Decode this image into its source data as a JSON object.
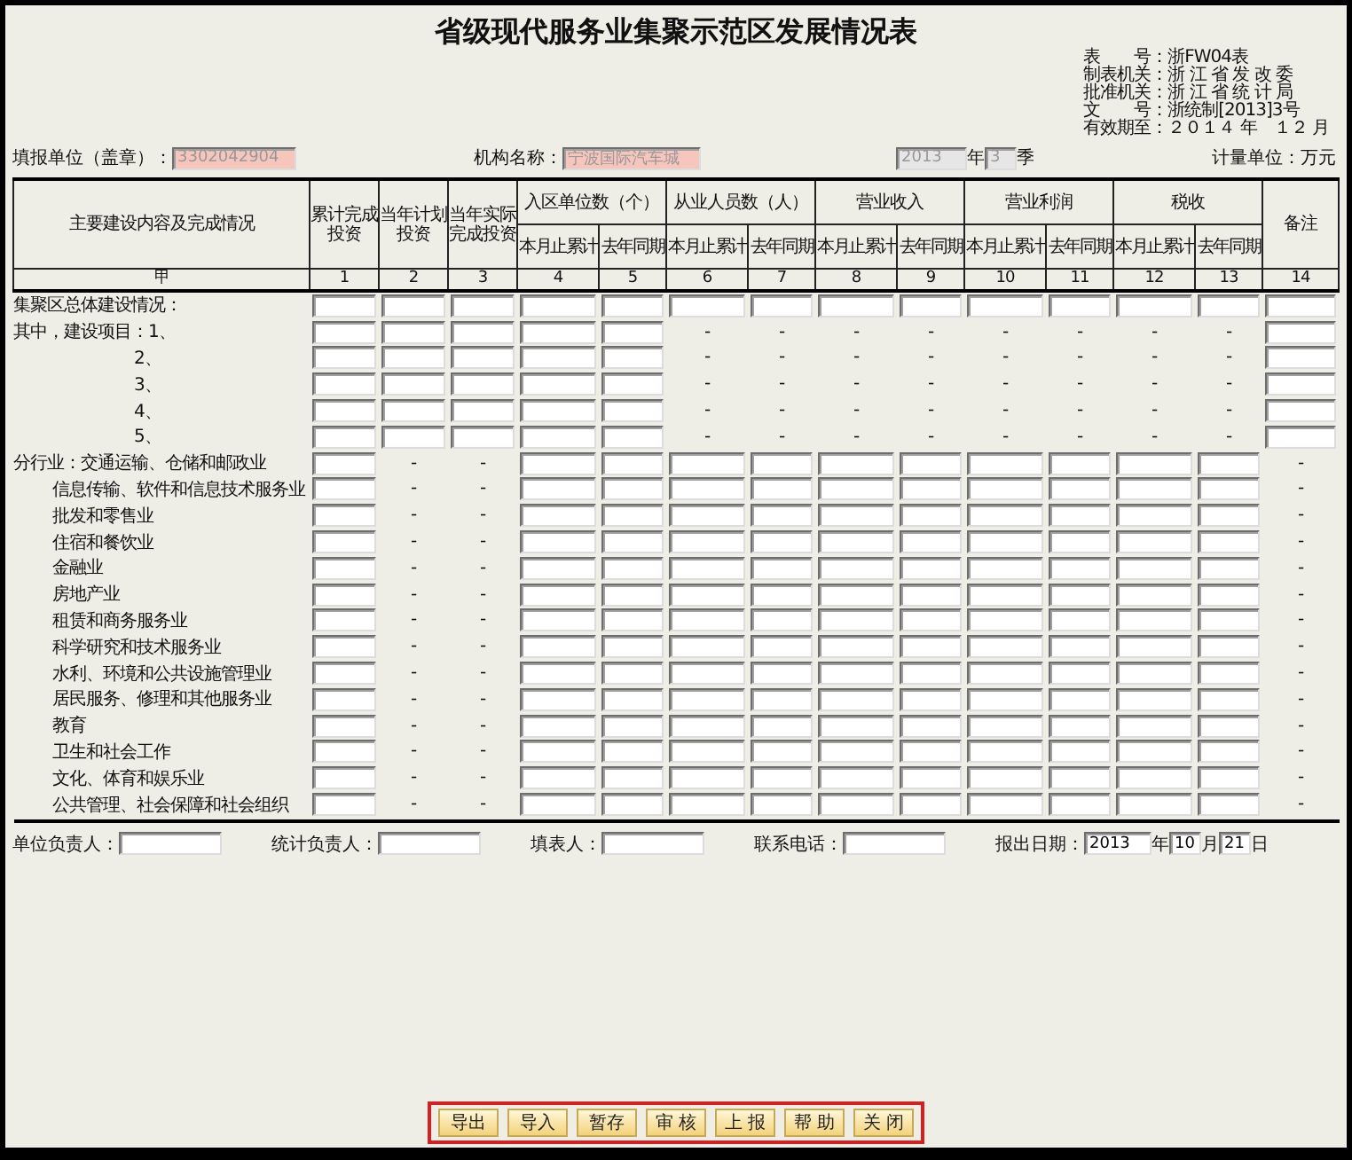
{
  "title": "省级现代服务业集聚示范区发展情况表",
  "form_info": [
    {
      "label": "表　　号：",
      "value": "浙FW04表"
    },
    {
      "label": "制表机关：",
      "value": "浙 江 省 发 改 委"
    },
    {
      "label": "批准机关：",
      "value": "浙 江 省 统 计 局"
    },
    {
      "label": "文　　号：",
      "value": "浙统制[2013]3号"
    },
    {
      "label": "有效期至：",
      "value": "２０１４ 年　１２ 月"
    }
  ],
  "unit_row": {
    "reporter_label": "填报单位（盖章）：",
    "reporter": {
      "value": "3302042904",
      "disabled": true
    },
    "org_label": "机构名称：",
    "org": {
      "value": "宁波国际汽车城",
      "disabled": true
    },
    "year": {
      "value": "2013",
      "disabled": true
    },
    "year_unit": "年",
    "quarter": {
      "value": "3",
      "disabled": true
    },
    "quarter_unit": "季",
    "measure_label": "计量单位：万",
    "measure_unit": "元"
  },
  "table": {
    "row_head": "主要建设内容及完成情况",
    "single_columns": [
      "累计完成投资",
      "当年计划投资",
      "当年实际完成投资"
    ],
    "groups": [
      {
        "label": "入区单位数（个）",
        "sub": [
          "本月止累计",
          "去年同期"
        ]
      },
      {
        "label": "从业人员数（人）",
        "sub": [
          "本月止累计",
          "去年同期"
        ]
      },
      {
        "label": "营业收入",
        "sub": [
          "本月止累计",
          "去年同期"
        ]
      },
      {
        "label": "营业利润",
        "sub": [
          "本月止累计",
          "去年同期"
        ]
      },
      {
        "label": "税收",
        "sub": [
          "本月止累计",
          "去年同期"
        ]
      }
    ],
    "remark_head": "备注",
    "numbers": [
      "甲",
      "1",
      "2",
      "3",
      "4",
      "5",
      "6",
      "7",
      "8",
      "9",
      "10",
      "11",
      "12",
      "13",
      "14"
    ],
    "rows": [
      {
        "kind": "total",
        "label": "集聚区总体建设情况：",
        "cells": [
          {
            "kind": "field"
          },
          {
            "kind": "field"
          },
          {
            "kind": "field"
          },
          {
            "kind": "field"
          },
          {
            "kind": "field"
          },
          {
            "kind": "field"
          },
          {
            "kind": "field"
          },
          {
            "kind": "field"
          },
          {
            "kind": "field"
          },
          {
            "kind": "field"
          },
          {
            "kind": "field"
          },
          {
            "kind": "field"
          },
          {
            "kind": "field"
          },
          {
            "kind": "field"
          }
        ]
      },
      {
        "kind": "head",
        "label": "其中，建设项目：1、",
        "cells": [
          {
            "kind": "field"
          },
          {
            "kind": "field"
          },
          {
            "kind": "field"
          },
          {
            "kind": "field"
          },
          {
            "kind": "field"
          },
          {
            "kind": "dash",
            "text": "-"
          },
          {
            "kind": "dash",
            "text": "-"
          },
          {
            "kind": "dash",
            "text": "-"
          },
          {
            "kind": "dash",
            "text": "-"
          },
          {
            "kind": "dash",
            "text": "-"
          },
          {
            "kind": "dash",
            "text": "-"
          },
          {
            "kind": "dash",
            "text": "-"
          },
          {
            "kind": "dash",
            "text": "-"
          },
          {
            "kind": "field"
          }
        ]
      },
      {
        "kind": "number",
        "label": "2、",
        "cells": [
          {
            "kind": "field"
          },
          {
            "kind": "field"
          },
          {
            "kind": "field"
          },
          {
            "kind": "field"
          },
          {
            "kind": "field"
          },
          {
            "kind": "dash",
            "text": "-"
          },
          {
            "kind": "dash",
            "text": "-"
          },
          {
            "kind": "dash",
            "text": "-"
          },
          {
            "kind": "dash",
            "text": "-"
          },
          {
            "kind": "dash",
            "text": "-"
          },
          {
            "kind": "dash",
            "text": "-"
          },
          {
            "kind": "dash",
            "text": "-"
          },
          {
            "kind": "dash",
            "text": "-"
          },
          {
            "kind": "field"
          }
        ]
      },
      {
        "kind": "number",
        "label": "3、",
        "cells": [
          {
            "kind": "field"
          },
          {
            "kind": "field"
          },
          {
            "kind": "field"
          },
          {
            "kind": "field"
          },
          {
            "kind": "field"
          },
          {
            "kind": "dash",
            "text": "-"
          },
          {
            "kind": "dash",
            "text": "-"
          },
          {
            "kind": "dash",
            "text": "-"
          },
          {
            "kind": "dash",
            "text": "-"
          },
          {
            "kind": "dash",
            "text": "-"
          },
          {
            "kind": "dash",
            "text": "-"
          },
          {
            "kind": "dash",
            "text": "-"
          },
          {
            "kind": "dash",
            "text": "-"
          },
          {
            "kind": "field"
          }
        ]
      },
      {
        "kind": "number",
        "label": "4、",
        "cells": [
          {
            "kind": "field"
          },
          {
            "kind": "field"
          },
          {
            "kind": "field"
          },
          {
            "kind": "field"
          },
          {
            "kind": "field"
          },
          {
            "kind": "dash",
            "text": "-"
          },
          {
            "kind": "dash",
            "text": "-"
          },
          {
            "kind": "dash",
            "text": "-"
          },
          {
            "kind": "dash",
            "text": "-"
          },
          {
            "kind": "dash",
            "text": "-"
          },
          {
            "kind": "dash",
            "text": "-"
          },
          {
            "kind": "dash",
            "text": "-"
          },
          {
            "kind": "dash",
            "text": "-"
          },
          {
            "kind": "field"
          }
        ]
      },
      {
        "kind": "number",
        "label": "5、",
        "cells": [
          {
            "kind": "field"
          },
          {
            "kind": "field"
          },
          {
            "kind": "field"
          },
          {
            "kind": "field"
          },
          {
            "kind": "field"
          },
          {
            "kind": "dash",
            "text": "-"
          },
          {
            "kind": "dash",
            "text": "-"
          },
          {
            "kind": "dash",
            "text": "-"
          },
          {
            "kind": "dash",
            "text": "-"
          },
          {
            "kind": "dash",
            "text": "-"
          },
          {
            "kind": "dash",
            "text": "-"
          },
          {
            "kind": "dash",
            "text": "-"
          },
          {
            "kind": "dash",
            "text": "-"
          },
          {
            "kind": "field"
          }
        ]
      },
      {
        "kind": "head",
        "label": "分行业：交通运输、仓储和邮政业",
        "cells": [
          {
            "kind": "field"
          },
          {
            "kind": "dash",
            "text": "-"
          },
          {
            "kind": "dash",
            "text": "-"
          },
          {
            "kind": "field"
          },
          {
            "kind": "field"
          },
          {
            "kind": "field"
          },
          {
            "kind": "field"
          },
          {
            "kind": "field"
          },
          {
            "kind": "field"
          },
          {
            "kind": "field"
          },
          {
            "kind": "field"
          },
          {
            "kind": "field"
          },
          {
            "kind": "field"
          },
          {
            "kind": "dash",
            "text": "-"
          }
        ]
      },
      {
        "kind": "industry",
        "label": "信息传输、软件和信息技术服务业",
        "cells": [
          {
            "kind": "field"
          },
          {
            "kind": "dash",
            "text": "-"
          },
          {
            "kind": "dash",
            "text": "-"
          },
          {
            "kind": "field"
          },
          {
            "kind": "field"
          },
          {
            "kind": "field"
          },
          {
            "kind": "field"
          },
          {
            "kind": "field"
          },
          {
            "kind": "field"
          },
          {
            "kind": "field"
          },
          {
            "kind": "field"
          },
          {
            "kind": "field"
          },
          {
            "kind": "field"
          },
          {
            "kind": "dash",
            "text": "-"
          }
        ]
      },
      {
        "kind": "industry",
        "label": "批发和零售业",
        "cells": [
          {
            "kind": "field"
          },
          {
            "kind": "dash",
            "text": "-"
          },
          {
            "kind": "dash",
            "text": "-"
          },
          {
            "kind": "field"
          },
          {
            "kind": "field"
          },
          {
            "kind": "field"
          },
          {
            "kind": "field"
          },
          {
            "kind": "field"
          },
          {
            "kind": "field"
          },
          {
            "kind": "field"
          },
          {
            "kind": "field"
          },
          {
            "kind": "field"
          },
          {
            "kind": "field"
          },
          {
            "kind": "dash",
            "text": "-"
          }
        ]
      },
      {
        "kind": "industry",
        "label": "住宿和餐饮业",
        "cells": [
          {
            "kind": "field"
          },
          {
            "kind": "dash",
            "text": "-"
          },
          {
            "kind": "dash",
            "text": "-"
          },
          {
            "kind": "field"
          },
          {
            "kind": "field"
          },
          {
            "kind": "field"
          },
          {
            "kind": "field"
          },
          {
            "kind": "field"
          },
          {
            "kind": "field"
          },
          {
            "kind": "field"
          },
          {
            "kind": "field"
          },
          {
            "kind": "field"
          },
          {
            "kind": "field"
          },
          {
            "kind": "dash",
            "text": "-"
          }
        ]
      },
      {
        "kind": "industry",
        "label": "金融业",
        "cells": [
          {
            "kind": "field"
          },
          {
            "kind": "dash",
            "text": "-"
          },
          {
            "kind": "dash",
            "text": "-"
          },
          {
            "kind": "field"
          },
          {
            "kind": "field"
          },
          {
            "kind": "field"
          },
          {
            "kind": "field"
          },
          {
            "kind": "field"
          },
          {
            "kind": "field"
          },
          {
            "kind": "field"
          },
          {
            "kind": "field"
          },
          {
            "kind": "field"
          },
          {
            "kind": "field"
          },
          {
            "kind": "dash",
            "text": "-"
          }
        ]
      },
      {
        "kind": "industry",
        "label": "房地产业",
        "cells": [
          {
            "kind": "field"
          },
          {
            "kind": "dash",
            "text": "-"
          },
          {
            "kind": "dash",
            "text": "-"
          },
          {
            "kind": "field"
          },
          {
            "kind": "field"
          },
          {
            "kind": "field"
          },
          {
            "kind": "field"
          },
          {
            "kind": "field"
          },
          {
            "kind": "field"
          },
          {
            "kind": "field"
          },
          {
            "kind": "field"
          },
          {
            "kind": "field"
          },
          {
            "kind": "field"
          },
          {
            "kind": "dash",
            "text": "-"
          }
        ]
      },
      {
        "kind": "industry",
        "label": "租赁和商务服务业",
        "cells": [
          {
            "kind": "field"
          },
          {
            "kind": "dash",
            "text": "-"
          },
          {
            "kind": "dash",
            "text": "-"
          },
          {
            "kind": "field"
          },
          {
            "kind": "field"
          },
          {
            "kind": "field"
          },
          {
            "kind": "field"
          },
          {
            "kind": "field"
          },
          {
            "kind": "field"
          },
          {
            "kind": "field"
          },
          {
            "kind": "field"
          },
          {
            "kind": "field"
          },
          {
            "kind": "field"
          },
          {
            "kind": "dash",
            "text": "-"
          }
        ]
      },
      {
        "kind": "industry",
        "label": "科学研究和技术服务业",
        "cells": [
          {
            "kind": "field"
          },
          {
            "kind": "dash",
            "text": "-"
          },
          {
            "kind": "dash",
            "text": "-"
          },
          {
            "kind": "field"
          },
          {
            "kind": "field"
          },
          {
            "kind": "field"
          },
          {
            "kind": "field"
          },
          {
            "kind": "field"
          },
          {
            "kind": "field"
          },
          {
            "kind": "field"
          },
          {
            "kind": "field"
          },
          {
            "kind": "field"
          },
          {
            "kind": "field"
          },
          {
            "kind": "dash",
            "text": "-"
          }
        ]
      },
      {
        "kind": "industry",
        "label": "水利、环境和公共设施管理业",
        "cells": [
          {
            "kind": "field"
          },
          {
            "kind": "dash",
            "text": "-"
          },
          {
            "kind": "dash",
            "text": "-"
          },
          {
            "kind": "field"
          },
          {
            "kind": "field"
          },
          {
            "kind": "field"
          },
          {
            "kind": "field"
          },
          {
            "kind": "field"
          },
          {
            "kind": "field"
          },
          {
            "kind": "field"
          },
          {
            "kind": "field"
          },
          {
            "kind": "field"
          },
          {
            "kind": "field"
          },
          {
            "kind": "dash",
            "text": "-"
          }
        ]
      },
      {
        "kind": "industry",
        "label": "居民服务、修理和其他服务业",
        "cells": [
          {
            "kind": "field"
          },
          {
            "kind": "dash",
            "text": "-"
          },
          {
            "kind": "dash",
            "text": "-"
          },
          {
            "kind": "field"
          },
          {
            "kind": "field"
          },
          {
            "kind": "field"
          },
          {
            "kind": "field"
          },
          {
            "kind": "field"
          },
          {
            "kind": "field"
          },
          {
            "kind": "field"
          },
          {
            "kind": "field"
          },
          {
            "kind": "field"
          },
          {
            "kind": "field"
          },
          {
            "kind": "dash",
            "text": "-"
          }
        ]
      },
      {
        "kind": "industry",
        "label": "教育",
        "cells": [
          {
            "kind": "field"
          },
          {
            "kind": "dash",
            "text": "-"
          },
          {
            "kind": "dash",
            "text": "-"
          },
          {
            "kind": "field"
          },
          {
            "kind": "field"
          },
          {
            "kind": "field"
          },
          {
            "kind": "field"
          },
          {
            "kind": "field"
          },
          {
            "kind": "field"
          },
          {
            "kind": "field"
          },
          {
            "kind": "field"
          },
          {
            "kind": "field"
          },
          {
            "kind": "field"
          },
          {
            "kind": "dash",
            "text": "-"
          }
        ]
      },
      {
        "kind": "industry",
        "label": "卫生和社会工作",
        "cells": [
          {
            "kind": "field"
          },
          {
            "kind": "dash",
            "text": "-"
          },
          {
            "kind": "dash",
            "text": "-"
          },
          {
            "kind": "field"
          },
          {
            "kind": "field"
          },
          {
            "kind": "field"
          },
          {
            "kind": "field"
          },
          {
            "kind": "field"
          },
          {
            "kind": "field"
          },
          {
            "kind": "field"
          },
          {
            "kind": "field"
          },
          {
            "kind": "field"
          },
          {
            "kind": "field"
          },
          {
            "kind": "dash",
            "text": "-"
          }
        ]
      },
      {
        "kind": "industry",
        "label": "文化、体育和娱乐业",
        "cells": [
          {
            "kind": "field"
          },
          {
            "kind": "dash",
            "text": "-"
          },
          {
            "kind": "dash",
            "text": "-"
          },
          {
            "kind": "field"
          },
          {
            "kind": "field"
          },
          {
            "kind": "field"
          },
          {
            "kind": "field"
          },
          {
            "kind": "field"
          },
          {
            "kind": "field"
          },
          {
            "kind": "field"
          },
          {
            "kind": "field"
          },
          {
            "kind": "field"
          },
          {
            "kind": "field"
          },
          {
            "kind": "dash",
            "text": "-"
          }
        ]
      },
      {
        "kind": "industry",
        "label": "公共管理、社会保障和社会组织",
        "cells": [
          {
            "kind": "field"
          },
          {
            "kind": "dash",
            "text": "-"
          },
          {
            "kind": "dash",
            "text": "-"
          },
          {
            "kind": "field"
          },
          {
            "kind": "field"
          },
          {
            "kind": "field"
          },
          {
            "kind": "field"
          },
          {
            "kind": "field"
          },
          {
            "kind": "field"
          },
          {
            "kind": "field"
          },
          {
            "kind": "field"
          },
          {
            "kind": "field"
          },
          {
            "kind": "field"
          },
          {
            "kind": "dash",
            "text": "-"
          }
        ]
      }
    ]
  },
  "signers": [
    {
      "label": "单位负责人："
    },
    {
      "label": "统计负责人："
    },
    {
      "label": "填表人："
    },
    {
      "label": "联系电话："
    }
  ],
  "report_date": {
    "label": "报出日期：",
    "parts": [
      {
        "value": "2013",
        "unit": "年"
      },
      {
        "value": "10",
        "unit": "月"
      },
      {
        "value": "21",
        "unit": "日"
      }
    ]
  },
  "buttons": [
    "导出",
    "导入",
    "暂存",
    "审 核",
    "上 报",
    "帮 助",
    "关 闭"
  ]
}
